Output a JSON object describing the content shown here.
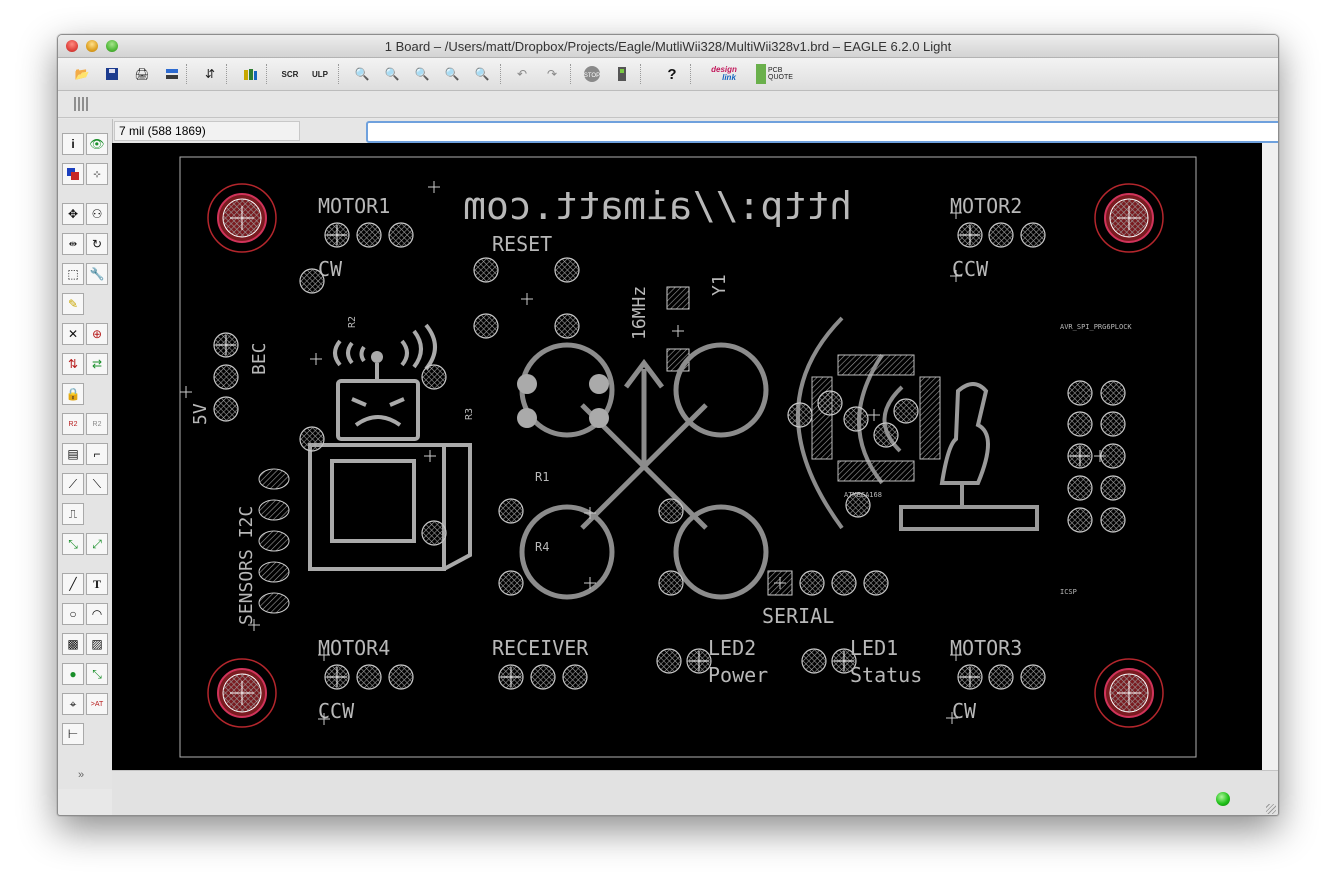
{
  "window": {
    "title": "1 Board – /Users/matt/Dropbox/Projects/Eagle/MutliWii328/MultiWii328v1.brd – EAGLE 6.2.0 Light"
  },
  "toolbar": {
    "buttons": [
      "open-icon",
      "save-icon",
      "print-icon",
      "cam-icon",
      "script-icon",
      "library-icon",
      "scr-icon",
      "ulp-icon",
      "zoom-fit-icon",
      "zoom-in-icon",
      "zoom-out-icon",
      "zoom-redraw-icon",
      "zoom-area-icon",
      "undo-icon",
      "redo-icon",
      "stop-icon",
      "go-icon",
      "help-icon"
    ],
    "design_link": {
      "line1": "design",
      "line2": "link"
    },
    "pcb_quote": {
      "line1": "PCB",
      "line2": "QUOTE"
    }
  },
  "command": {
    "coordinates": "7 mil (588 1869)",
    "value": "",
    "placeholder": ""
  },
  "board": {
    "url_text": "http://aimatt.com",
    "labels": {
      "motor1": "MOTOR1",
      "motor2": "MOTOR2",
      "motor3": "MOTOR3",
      "motor4": "MOTOR4",
      "cw1": "CW",
      "cw2": "CCW",
      "cw3": "CW",
      "cw4": "CCW",
      "reset": "RESET",
      "freq": "16MHz",
      "y1": "Y1",
      "bec": "BEC",
      "v5": "5V",
      "r2": "R2",
      "r3": "R3",
      "r1": "R1",
      "r4": "R4",
      "sensors": "SENSORS I2C",
      "receiver": "RECEIVER",
      "serial": "SERIAL",
      "led2": "LED2",
      "power": "Power",
      "led1": "LED1",
      "status": "Status",
      "avr": "AVR_SPI_PRG6PLOCK",
      "icsp": "ICSP",
      "atmega": "ATMEGA168"
    }
  },
  "colors": {
    "canvas": "#000000",
    "silk": "#b8b8b8",
    "pad_outline": "#c8c8c8",
    "hole_ring": "#b3262c",
    "status_led": "#21c21a"
  }
}
